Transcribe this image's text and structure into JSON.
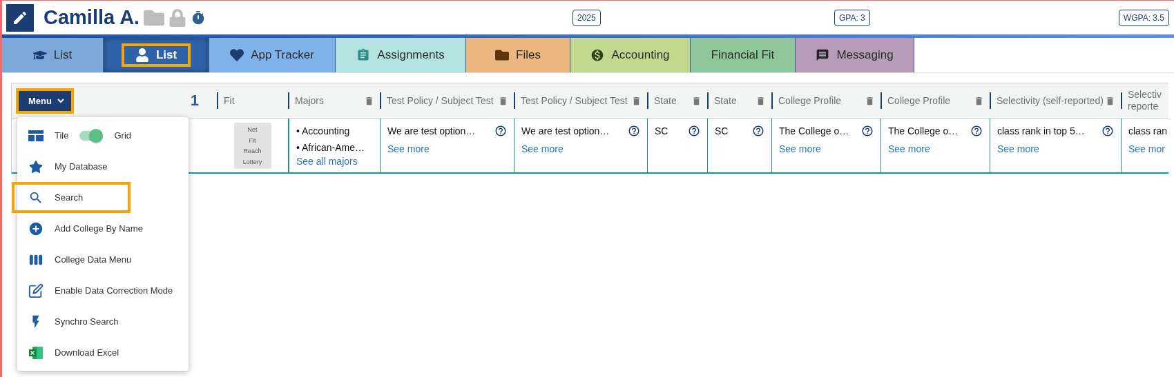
{
  "header": {
    "name": "Camilla A.",
    "badges": [
      "2025",
      "GPA: 3",
      "WGPA: 3.5"
    ]
  },
  "tabs": [
    {
      "label": "List",
      "color": "#7ba7d9",
      "selected": false,
      "highlighted": false
    },
    {
      "label": "List",
      "color": "#2f62a8",
      "selected": true,
      "highlighted": true
    },
    {
      "label": "App Tracker",
      "color": "#80b2ea",
      "selected": false,
      "highlighted": false
    },
    {
      "label": "Assignments",
      "color": "#b3e3e1",
      "selected": false,
      "highlighted": false
    },
    {
      "label": "Files",
      "color": "#ebb77f",
      "selected": false,
      "highlighted": false
    },
    {
      "label": "Accounting",
      "color": "#c0d98f",
      "selected": false,
      "highlighted": false
    },
    {
      "label": "Financial Fit",
      "color": "#8fc699",
      "selected": false,
      "highlighted": false
    },
    {
      "label": "Messaging",
      "color": "#b69cb9",
      "selected": false,
      "highlighted": false
    }
  ],
  "menu_button": {
    "label": "Menu",
    "highlighted": true,
    "expanded": true
  },
  "menu": [
    {
      "kind": "toggle",
      "label": "Tile",
      "label_on": "Grid",
      "on": true,
      "highlighted": false
    },
    {
      "kind": "item",
      "label": "My Database",
      "highlighted": false
    },
    {
      "kind": "item",
      "label": "Search",
      "highlighted": true
    },
    {
      "kind": "item",
      "label": "Add College By Name",
      "highlighted": false
    },
    {
      "kind": "item",
      "label": "College Data Menu",
      "highlighted": false
    },
    {
      "kind": "item",
      "label": "Enable Data Correction Mode",
      "highlighted": false
    },
    {
      "kind": "item",
      "label": "Synchro Search",
      "highlighted": false
    },
    {
      "kind": "item",
      "label": "Download Excel",
      "highlighted": false
    }
  ],
  "table": {
    "count": "1",
    "columns": [
      {
        "heading": "Fit",
        "kind": "plain"
      },
      {
        "heading": "Majors",
        "kind": "removable"
      },
      {
        "heading": "Test Policy / Subject Test",
        "kind": "removable"
      },
      {
        "heading": "Test Policy / Subject Test",
        "kind": "removable"
      },
      {
        "heading": "State",
        "kind": "removable"
      },
      {
        "heading": "State",
        "kind": "removable"
      },
      {
        "heading": "College Profile",
        "kind": "removable"
      },
      {
        "heading": "College Profile",
        "kind": "removable"
      },
      {
        "heading": "Selectivity (self-reported)",
        "kind": "removable"
      },
      {
        "heading": "Selectiv reporte",
        "kind": "plain"
      }
    ],
    "row": [
      {
        "kind": "fit",
        "lines": [
          "Net",
          "Fit",
          "Reach",
          "Lottery"
        ]
      },
      {
        "kind": "list",
        "items": [
          "• Accounting",
          "• African-Ame…"
        ],
        "link": "See all majors"
      },
      {
        "kind": "text",
        "text": "We are test option…",
        "help": true,
        "link": "See more"
      },
      {
        "kind": "text",
        "text": "We are test option…",
        "help": true,
        "link": "See more"
      },
      {
        "kind": "text",
        "text": "SC",
        "help": true
      },
      {
        "kind": "text",
        "text": "SC",
        "help": true
      },
      {
        "kind": "text",
        "text": "The College o…",
        "help": true,
        "link": "See more"
      },
      {
        "kind": "text",
        "text": "The College o…",
        "help": true,
        "link": "See more"
      },
      {
        "kind": "text",
        "text": "class rank in top 5…",
        "help": true,
        "link": "See more"
      },
      {
        "kind": "text",
        "text": "class ran",
        "link": "See mor"
      }
    ]
  }
}
